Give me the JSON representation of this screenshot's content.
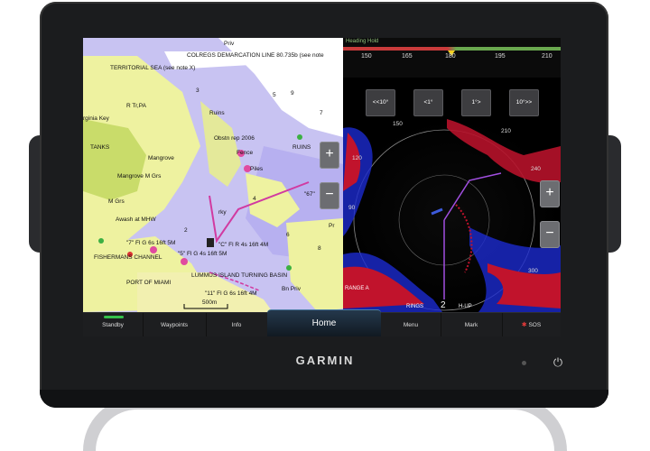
{
  "chart": {
    "labels": [
      "Priv",
      "COLREGS DEMARCATION LINE 80.735b (see note",
      "TERRITORIAL SEA (see note X)",
      "R Tr,PA",
      "rginia Key",
      "TANKS",
      "Mangrove",
      "Ruins",
      "Obstn rep 2006",
      "Fence",
      "Piles",
      "RUINS",
      "Mangrove M Grs",
      "M Grs",
      "Awash at MHW",
      "\"67\"",
      "rky",
      "\"7\" Fl G 6s 16ft 5M",
      "\"5\" Fl G 4s 16ft 5M",
      "FISHERMANS CHANNEL",
      "LUMMUS ISLAND TURNING BASIN",
      "PORT OF MIAMI",
      "\"C\" Fl R 4s 16ft 4M",
      "\"11\" Fl G 6s 16ft 4M",
      "Bn Priv",
      "Pr",
      "500m"
    ],
    "depths": [
      "2",
      "3",
      "4",
      "5",
      "6",
      "7",
      "8",
      "9"
    ]
  },
  "heading": {
    "title": "Heading Hold",
    "ticks": [
      "150",
      "165",
      "180",
      "195",
      "210"
    ]
  },
  "steer_buttons": [
    "<<10°",
    "<1°",
    "1°>",
    "10°>>"
  ],
  "radar": {
    "bearings": [
      "150",
      "210",
      "120",
      "240",
      "90",
      "300"
    ],
    "range_label": "RANGE A",
    "rings_label": "RINGS",
    "orientation_label": "H-UP",
    "range_value": "2"
  },
  "zoom": {
    "plus": "+",
    "minus": "−"
  },
  "menu": {
    "standby": "Standby",
    "waypoints": "Waypoints",
    "info": "Info",
    "home": "Home",
    "menu": "Menu",
    "mark": "Mark",
    "sos": "SOS"
  },
  "brand": "GARMIN",
  "power_icon": "⏻"
}
